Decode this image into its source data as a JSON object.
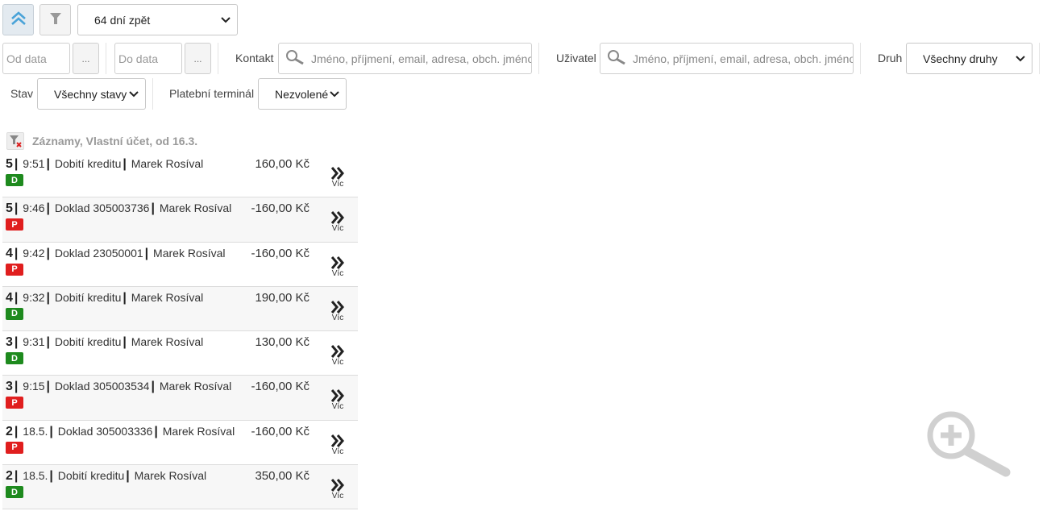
{
  "toolbar": {
    "range_select": "64 dní zpět"
  },
  "filters": {
    "date_from_placeholder": "Od data",
    "date_to_placeholder": "Do data",
    "dots_label": "...",
    "contact_label": "Kontakt",
    "contact_placeholder": "Jméno, příjmení, email, adresa, obch. jméno",
    "user_label": "Uživatel",
    "user_placeholder": "Jméno, příjmení, email, adresa, obch. jméno",
    "type_label": "Druh",
    "type_select": "Všechny druhy",
    "state_label": "Stav",
    "state_select": "Všechny stavy",
    "terminal_label": "Platební terminál",
    "terminal_select": "Nezvolené"
  },
  "records": {
    "header": "Záznamy, Vlastní účet, od 16.3.",
    "more_label": "Víc",
    "items": [
      {
        "num": "5",
        "time": "9:51",
        "desc": "Dobití kreditu",
        "user": "Marek Rosíval",
        "amount": "160,00 Kč",
        "badge": "D"
      },
      {
        "num": "5",
        "time": "9:46",
        "desc": "Doklad 305003736",
        "user": "Marek Rosíval",
        "amount": "-160,00 Kč",
        "badge": "P"
      },
      {
        "num": "4",
        "time": "9:42",
        "desc": "Doklad 23050001",
        "user": "Marek Rosíval",
        "amount": "-160,00 Kč",
        "badge": "P"
      },
      {
        "num": "4",
        "time": "9:32",
        "desc": "Dobití kreditu",
        "user": "Marek Rosíval",
        "amount": "190,00 Kč",
        "badge": "D"
      },
      {
        "num": "3",
        "time": "9:31",
        "desc": "Dobití kreditu",
        "user": "Marek Rosíval",
        "amount": "130,00 Kč",
        "badge": "D"
      },
      {
        "num": "3",
        "time": "9:15",
        "desc": "Doklad 305003534",
        "user": "Marek Rosíval",
        "amount": "-160,00 Kč",
        "badge": "P"
      },
      {
        "num": "2",
        "time": "18.5.",
        "desc": "Doklad 305003336",
        "user": "Marek Rosíval",
        "amount": "-160,00 Kč",
        "badge": "P"
      },
      {
        "num": "2",
        "time": "18.5.",
        "desc": "Dobití kreditu",
        "user": "Marek Rosíval",
        "amount": "350,00 Kč",
        "badge": "D"
      }
    ]
  },
  "colors": {
    "badge_d": "#1e8a1e",
    "badge_p": "#e01e1e",
    "accent": "#4aa3d8"
  }
}
